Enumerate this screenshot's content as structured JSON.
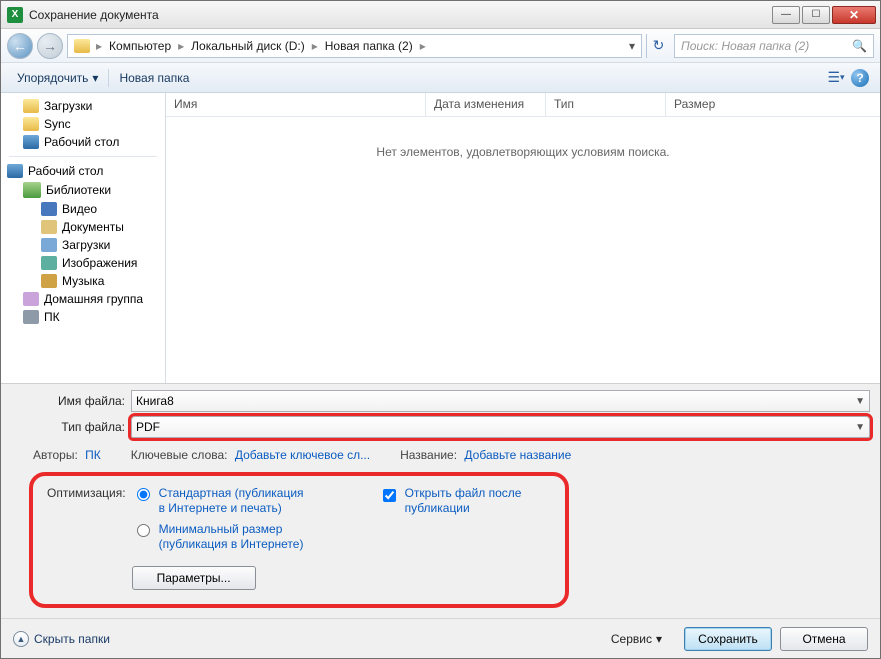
{
  "title": "Сохранение документа",
  "breadcrumb": [
    "Компьютер",
    "Локальный диск (D:)",
    "Новая папка (2)"
  ],
  "search_placeholder": "Поиск: Новая папка (2)",
  "toolbar": {
    "organize": "Упорядочить",
    "new_folder": "Новая папка"
  },
  "tree": {
    "fav_downloads": "Загрузки",
    "fav_sync": "Sync",
    "fav_desktop": "Рабочий стол",
    "desktop": "Рабочий стол",
    "libraries": "Библиотеки",
    "video": "Видео",
    "documents": "Документы",
    "downloads": "Загрузки",
    "pictures": "Изображения",
    "music": "Музыка",
    "homegroup": "Домашняя группа",
    "pc": "ПК"
  },
  "columns": {
    "name": "Имя",
    "date": "Дата изменения",
    "type": "Тип",
    "size": "Размер"
  },
  "empty_message": "Нет элементов, удовлетворяющих условиям поиска.",
  "form": {
    "filename_label": "Имя файла:",
    "filename_value": "Книга8",
    "filetype_label": "Тип файла:",
    "filetype_value": "PDF",
    "authors_label": "Авторы:",
    "authors_value": "ПК",
    "keywords_label": "Ключевые слова:",
    "keywords_add": "Добавьте ключевое сл...",
    "title_label": "Название:",
    "title_add": "Добавьте название",
    "optimize_label": "Оптимизация:",
    "opt_standard": "Стандартная (публикация в Интернете и печать)",
    "opt_min": "Минимальный размер (публикация в Интернете)",
    "open_after": "Открыть файл после публикации",
    "params_btn": "Параметры..."
  },
  "footer": {
    "hide_folders": "Скрыть папки",
    "service": "Сервис",
    "save": "Сохранить",
    "cancel": "Отмена"
  }
}
